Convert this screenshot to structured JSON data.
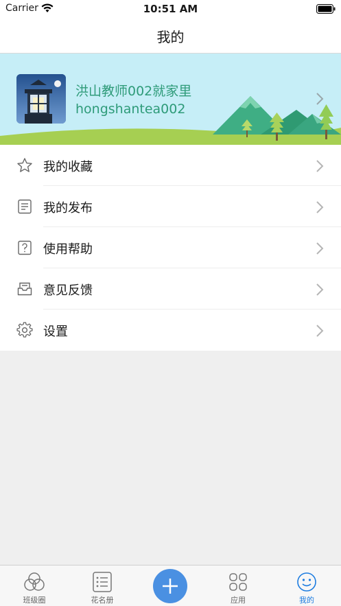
{
  "status_bar": {
    "carrier": "Carrier",
    "time": "10:51 AM"
  },
  "nav": {
    "title": "我的"
  },
  "profile": {
    "name": "洪山教师002就家里",
    "username": "hongshantea002"
  },
  "menu": {
    "items": [
      {
        "label": "我的收藏",
        "icon": "star-icon"
      },
      {
        "label": "我的发布",
        "icon": "document-icon"
      },
      {
        "label": "使用帮助",
        "icon": "help-icon"
      },
      {
        "label": "意见反馈",
        "icon": "feedback-icon"
      },
      {
        "label": "设置",
        "icon": "gear-icon"
      }
    ]
  },
  "tabs": [
    {
      "label": "班级圈",
      "icon": "circles-icon",
      "active": false
    },
    {
      "label": "花名册",
      "icon": "roster-icon",
      "active": false
    },
    {
      "label": "",
      "icon": "plus-icon",
      "active": false
    },
    {
      "label": "应用",
      "icon": "apps-icon",
      "active": false
    },
    {
      "label": "我的",
      "icon": "profile-icon",
      "active": true
    }
  ],
  "colors": {
    "accent": "#1e7de0",
    "banner_bg": "#c6eef7",
    "profile_text": "#2e9b79",
    "plus_button": "#4a90e2"
  }
}
